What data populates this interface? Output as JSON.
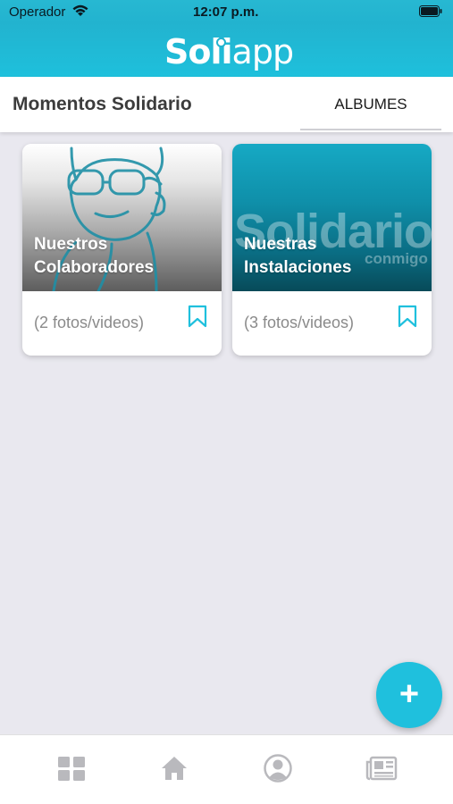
{
  "status_bar": {
    "carrier": "Operador",
    "time": "12:07 p.m."
  },
  "header": {
    "logo_part1": "Soli",
    "logo_part2": "app"
  },
  "tabs": {
    "title": "Momentos Solidario",
    "albumes": "ALBUMES"
  },
  "albums": [
    {
      "title_line1": "Nuestros",
      "title_line2": "Colaboradores",
      "count": "(2 fotos/videos)"
    },
    {
      "title_line1": "Nuestras",
      "title_line2": "Instalaciones",
      "count": "(3 fotos/videos)",
      "image_text": "Solidario",
      "image_subtext": "conmigo"
    }
  ],
  "fab": {
    "label": "+"
  },
  "nav": {
    "items": [
      "grid-icon",
      "home-icon",
      "profile-icon",
      "news-icon"
    ]
  },
  "colors": {
    "accent": "#1fc0dd",
    "header": "#22b3cf",
    "background": "#e9e8ef"
  }
}
